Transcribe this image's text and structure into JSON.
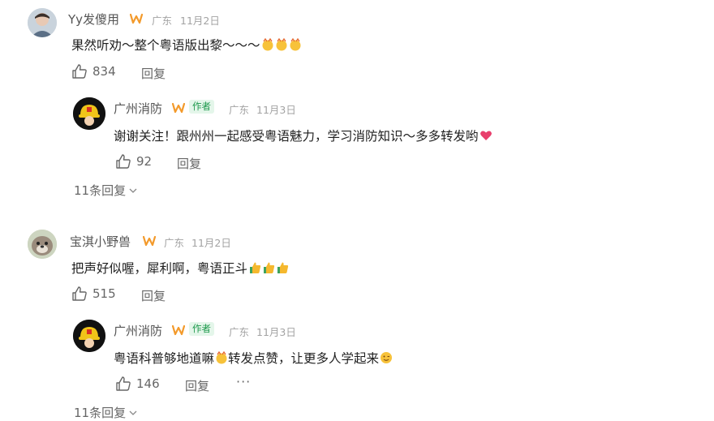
{
  "comments": [
    {
      "user": "Yy发傻用",
      "location": "广东",
      "date": "11月2日",
      "text": "果然听劝～整个粤语版出黎～～～",
      "likes": "834",
      "reply_label": "回复",
      "reply": {
        "user": "广州消防",
        "tag": "作者",
        "location": "广东",
        "date": "11月3日",
        "text": "谢谢关注！跟州州一起感受粤语魅力，学习消防知识～多多转发哟",
        "likes": "92",
        "reply_label": "回复"
      },
      "more_replies": "11条回复"
    },
    {
      "user": "宝淇小野兽",
      "location": "广东",
      "date": "11月2日",
      "text": "把声好似喔，犀利啊，粤语正斗",
      "likes": "515",
      "reply_label": "回复",
      "reply": {
        "user": "广州消防",
        "tag": "作者",
        "location": "广东",
        "date": "11月3日",
        "text_part1": "粤语科普够地道嘛",
        "text_part2": "转发点赞，让更多人学起来",
        "likes": "146",
        "reply_label": "回复"
      },
      "more_replies": "11条回复"
    }
  ],
  "colors": {
    "author_tag": "#1f9a4d",
    "meta": "#a3a3a3",
    "accent_heart": "#e83e6c"
  },
  "icons": [
    "thumbs-up-icon",
    "w-badge-icon",
    "chevron-down-icon",
    "more-dots-icon"
  ]
}
